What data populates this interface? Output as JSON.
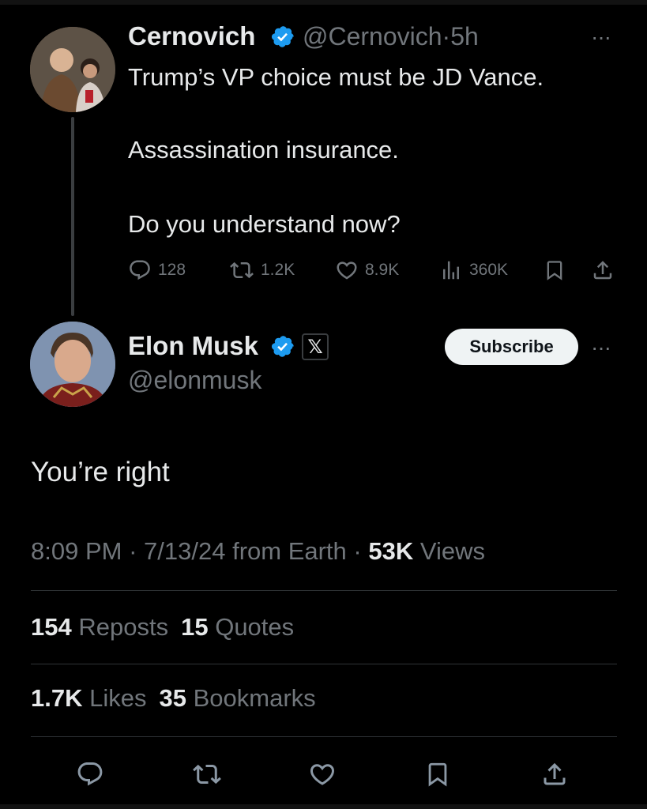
{
  "parent_tweet": {
    "name": "Cernovich",
    "handle": "@Cernovich",
    "separator": "·",
    "time": "5h",
    "more": "···",
    "lines": [
      "Trump’s VP choice must be JD Vance.",
      "Assassination insurance.",
      "Do you understand now?"
    ],
    "actions": {
      "replies": "128",
      "reposts": "1.2K",
      "likes": "8.9K",
      "views": "360K"
    },
    "icons": {
      "reply": "reply-icon",
      "repost": "repost-icon",
      "like": "heart-icon",
      "views": "views-icon",
      "bookmark": "bookmark-icon",
      "share": "share-icon"
    }
  },
  "main_tweet": {
    "name": "Elon Musk",
    "affiliate_badge": "𝕏",
    "handle": "@elonmusk",
    "subscribe_label": "Subscribe",
    "more": "···",
    "text": "You’re right",
    "meta": {
      "time": "8:09 PM",
      "separator": " · ",
      "date": "7/13/24",
      "source": "from Earth",
      "views_count": "53K",
      "views_label": "Views"
    },
    "stats_row_1": {
      "reposts_count": "154",
      "reposts_label": "Reposts",
      "quotes_count": "15",
      "quotes_label": "Quotes"
    },
    "stats_row_2": {
      "likes_count": "1.7K",
      "likes_label": "Likes",
      "bookmarks_count": "35",
      "bookmarks_label": "Bookmarks"
    },
    "bottom_actions": [
      "reply-icon",
      "repost-icon",
      "heart-icon",
      "bookmark-icon",
      "share-icon"
    ]
  },
  "colors": {
    "background": "#000000",
    "text_primary": "#e7e9ea",
    "text_secondary": "#71767b",
    "verified_blue": "#1d9bf0",
    "divider": "#2f3336",
    "subscribe_bg": "#eff3f4"
  }
}
